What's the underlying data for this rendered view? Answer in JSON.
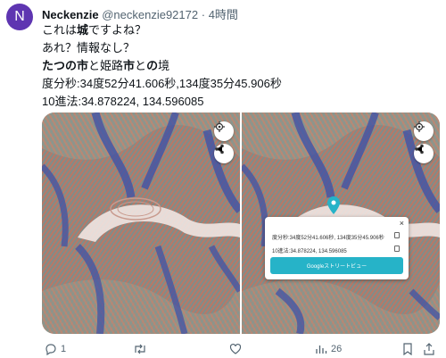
{
  "tweet": {
    "avatar_letter": "N",
    "display_name": "Neckenzie",
    "handle": "@neckenzie92172",
    "separator": "·",
    "time": "4時間",
    "lines": [
      {
        "segments": [
          {
            "text": "これは",
            "bold": false
          },
          {
            "text": "城",
            "bold": true
          },
          {
            "text": "ですよね？",
            "bold": false
          }
        ]
      },
      {
        "segments": [
          {
            "text": "あれ？情報なし？",
            "bold": false
          }
        ]
      },
      {
        "segments": [
          {
            "text": "たつの市",
            "bold": true
          },
          {
            "text": "と姫路",
            "bold": false
          },
          {
            "text": "市",
            "bold": true
          },
          {
            "text": "と",
            "bold": false
          },
          {
            "text": "の",
            "bold": true
          },
          {
            "text": "境",
            "bold": false
          }
        ]
      },
      {
        "segments": [
          {
            "text": "度分秒:34度52分41.606秒,134度35分45.906秒",
            "bold": false
          }
        ]
      },
      {
        "segments": [
          {
            "text": "10進法:34.878224, 134.596085",
            "bold": false
          }
        ]
      }
    ]
  },
  "popup": {
    "dms_text": "度分秒:34度52分41.606秒, 134度35分45.906秒",
    "decimal_text": "10進法:34.878224, 134.596085",
    "close_glyph": "×",
    "streetview_label": "Googleストリートビュー"
  },
  "actions": {
    "reply_count": "1",
    "retweet_count": "",
    "like_count": "",
    "views_count": "26"
  },
  "colors": {
    "avatar": "#5e35b1",
    "streetview_button": "#26b3c8",
    "pin": "#26b3c8",
    "muted_text": "#536471"
  },
  "icons": [
    "location-target-icon",
    "share-icon",
    "reply-icon",
    "retweet-icon",
    "like-icon",
    "views-icon",
    "bookmark-icon",
    "share-tweet-icon",
    "map-pin-icon",
    "copy-icon",
    "close-icon"
  ]
}
